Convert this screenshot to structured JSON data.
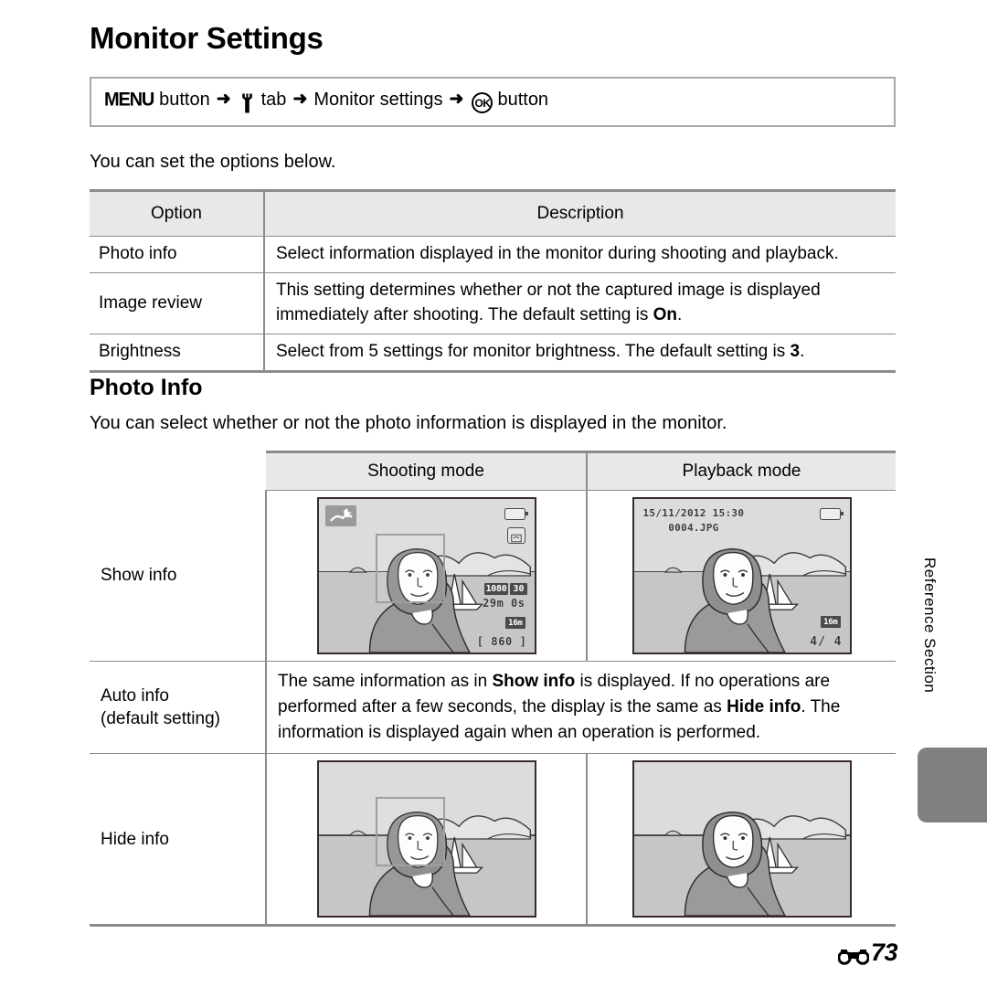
{
  "page": {
    "title": "Monitor Settings",
    "footer_page": "73",
    "footer_icon": "reference-section-icon",
    "side_tab_label": "Reference Section"
  },
  "nav_path": {
    "menu_label": "MENU",
    "button_word_1": "button",
    "arrow": "➜",
    "setup_tab_icon": "wrench-icon",
    "tab_word": "tab",
    "menu_item": "Monitor settings",
    "ok_label": "OK",
    "button_word_2": "button"
  },
  "intro": {
    "options_text": "You can set the options below.",
    "photo_info_text": "You can select whether or not the photo information is displayed in the monitor."
  },
  "options_table": {
    "headers": [
      "Option",
      "Description"
    ],
    "rows": [
      {
        "option": "Photo info",
        "description_parts": [
          {
            "text": "Select information displayed in the monitor during shooting and playback.",
            "bold": false
          }
        ]
      },
      {
        "option": "Image review",
        "description_parts": [
          {
            "text": "This setting determines whether or not the captured image is displayed immediately after shooting. The default setting is ",
            "bold": false
          },
          {
            "text": "On",
            "bold": true
          },
          {
            "text": ".",
            "bold": false
          }
        ]
      },
      {
        "option": "Brightness",
        "description_parts": [
          {
            "text": "Select from 5 settings for monitor brightness. The default setting is ",
            "bold": false
          },
          {
            "text": "3",
            "bold": true
          },
          {
            "text": ".",
            "bold": false
          }
        ]
      }
    ]
  },
  "photo_info_section": {
    "heading": "Photo Info",
    "headers": [
      "",
      "Shooting mode",
      "Playback mode"
    ],
    "rows": [
      {
        "label": "Show info",
        "type": "images",
        "shooting": "show-info-shooting-screen",
        "playback": "show-info-playback-screen"
      },
      {
        "label_line1": "Auto info",
        "label_line2": "(default setting)",
        "type": "text",
        "description_parts": [
          {
            "text": "The same information as in ",
            "bold": false
          },
          {
            "text": "Show info",
            "bold": true
          },
          {
            "text": " is displayed. If no operations are performed after a few seconds, the display is the same as ",
            "bold": false
          },
          {
            "text": "Hide info",
            "bold": true
          },
          {
            "text": ". The information is displayed again when an operation is performed.",
            "bold": false
          }
        ]
      },
      {
        "label": "Hide info",
        "type": "images",
        "shooting": "hide-info-shooting-screen",
        "playback": "hide-info-playback-screen"
      }
    ]
  },
  "monitor_osd": {
    "shooting_show": {
      "scene_icon": "scene-mode-icon",
      "battery_icon": "battery-icon",
      "vr_icon": "vibration-reduction-icon",
      "movie_size": "1080",
      "movie_fps": "30",
      "record_time": "29m 0s",
      "image_size": "16m",
      "shots_remaining": "[ 860 ]"
    },
    "playback_show": {
      "date": "15/11/2012  15:30",
      "filename": "0004.JPG",
      "battery_icon": "battery-icon",
      "image_size": "16m",
      "frame_counter": "4/  4"
    }
  },
  "colors": {
    "rule": "#8c8c8c",
    "header_fill": "#e8e8e8",
    "side_tab": "#808080",
    "monitor_border": "#3a2b2b",
    "monitor_sky": "#dcdcdc",
    "monitor_sea": "#c6c6c6"
  }
}
